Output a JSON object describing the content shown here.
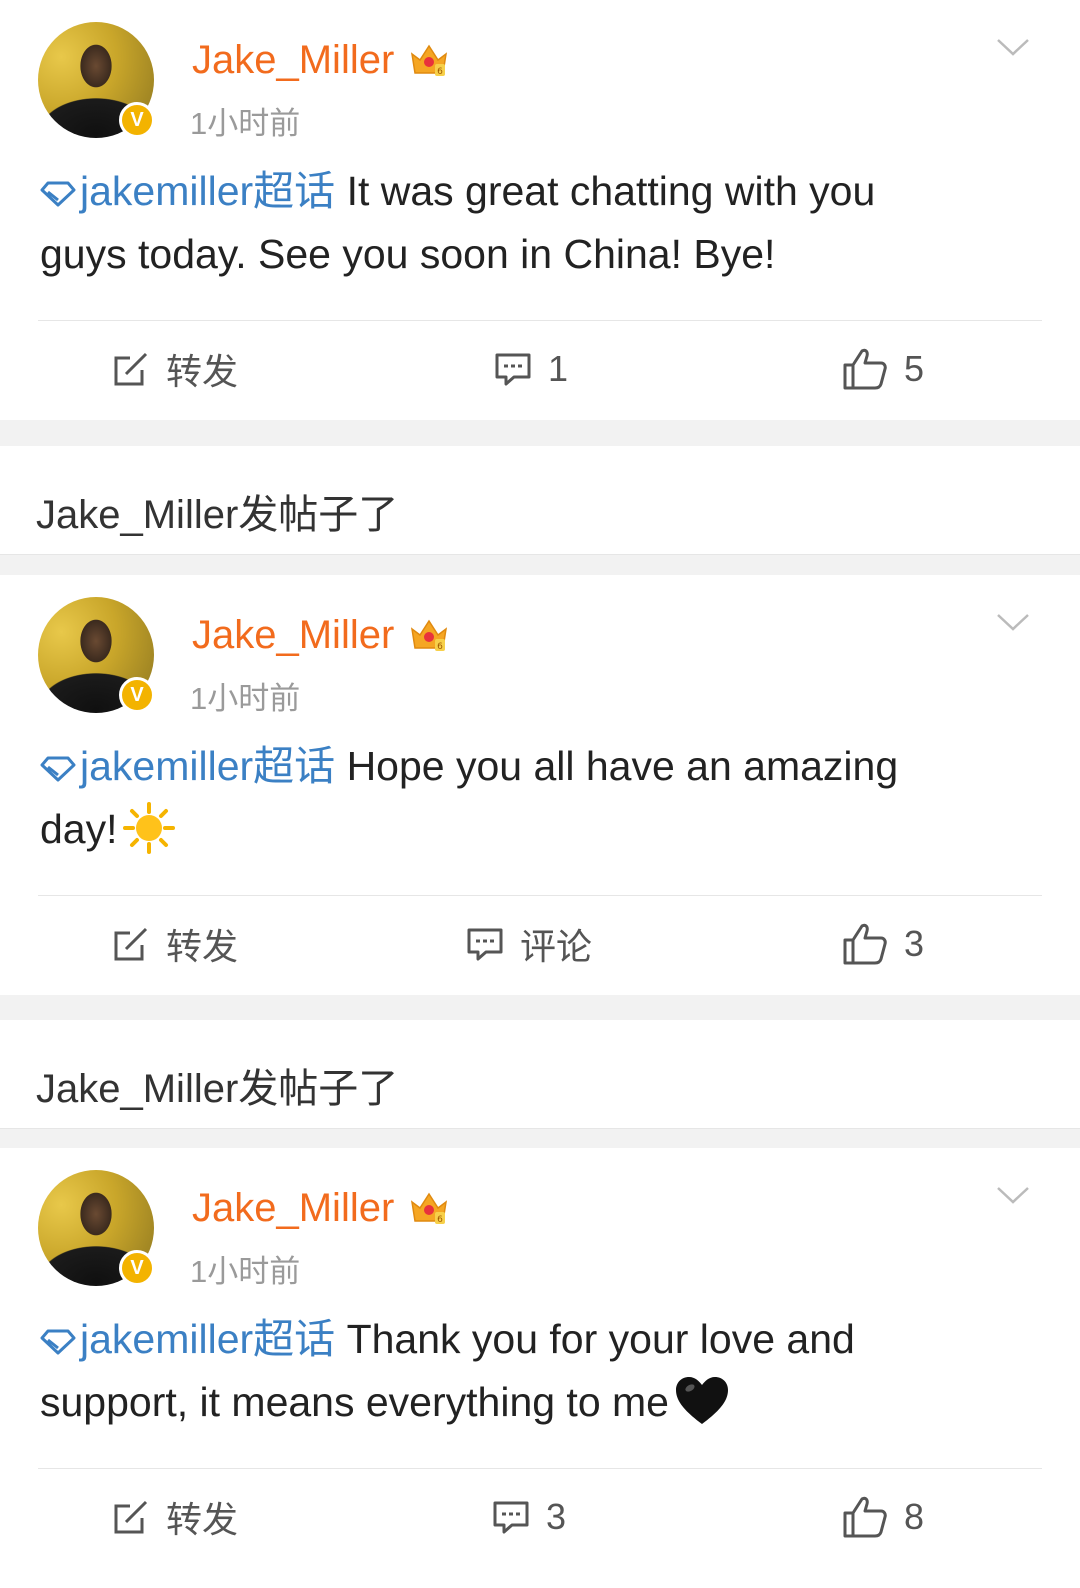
{
  "posts": [
    {
      "username": "Jake_Miller",
      "timestamp": "1小时前",
      "topic": "jakemiller超话",
      "text_line1": "It was great chatting with you",
      "text_line2": "guys today. See you soon in China! Bye!",
      "emoji": "",
      "repost_label": "转发",
      "comment_label": "1",
      "like_count": "5"
    },
    {
      "username": "Jake_Miller",
      "timestamp": "1小时前",
      "topic": "jakemiller超话",
      "text_line1": "Hope you all have an amazing",
      "text_line2": "day!",
      "emoji": "sun-emoji",
      "repost_label": "转发",
      "comment_label": "评论",
      "like_count": "3"
    },
    {
      "username": "Jake_Miller",
      "timestamp": "1小时前",
      "topic": "jakemiller超话",
      "text_line1": "Thank you for your love and",
      "text_line2": "support, it means everything to me",
      "emoji": "black-heart-emoji",
      "repost_label": "转发",
      "comment_label": "3",
      "like_count": "8"
    }
  ],
  "posted_labels": [
    "Jake_Miller发帖子了",
    "Jake_Miller发帖子了"
  ],
  "verified_badge": "V",
  "colors": {
    "username": "#f26b1d",
    "topic": "#3b80c4",
    "separator": "#f2f2f2",
    "verified": "#f3b300"
  }
}
